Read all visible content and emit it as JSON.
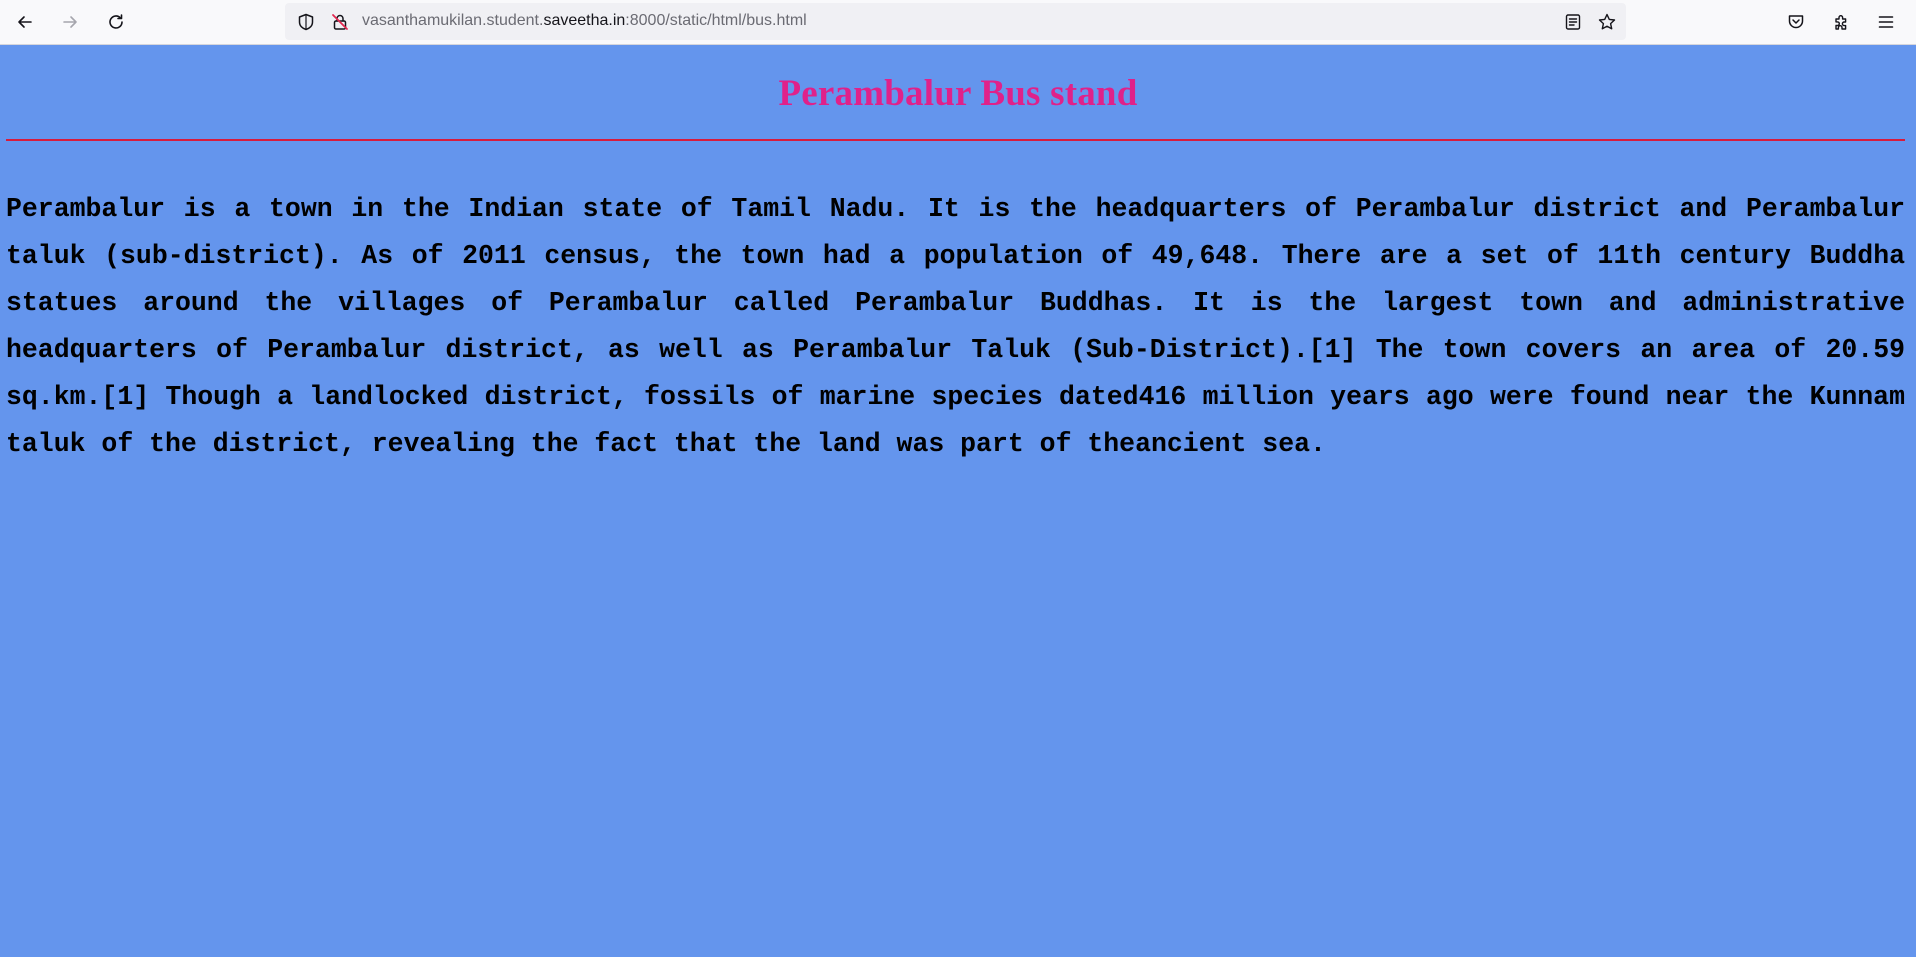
{
  "browser": {
    "url_prefix": "vasanthamukilan.student.",
    "url_domain": "saveetha.in",
    "url_suffix": ":8000/static/html/bus.html",
    "icons": {
      "back": "arrow-left-icon",
      "forward": "arrow-right-icon",
      "reload": "reload-icon",
      "tracking": "shield-icon",
      "insecure": "insecure-lock-icon",
      "reader": "reader-view-icon",
      "bookmark": "star-icon",
      "pocket": "pocket-icon",
      "extensions": "puzzle-icon",
      "menu": "hamburger-menu-icon"
    }
  },
  "page": {
    "background_color": "#6495ED",
    "title": "Perambalur Bus stand",
    "title_color": "#e0218a",
    "rule_color": "#d81b3c",
    "paragraph": "Perambalur is a town in the Indian state of Tamil Nadu. It is the headquarters of Perambalur district and Perambalur taluk (sub-district). As of 2011 census, the town had a population of 49,648. There are a set of 11th century Buddha statues around the villages of Perambalur called Perambalur Buddhas. It is the largest town and administrative headquarters of Perambalur district, as well as Perambalur Taluk (Sub-District).[1] The town covers an area of 20.59 sq.km.[1] Though a landlocked district, fossils of marine species dated416 million years ago were found near the Kunnam taluk of the district, revealing the fact that the land was part of theancient sea."
  }
}
